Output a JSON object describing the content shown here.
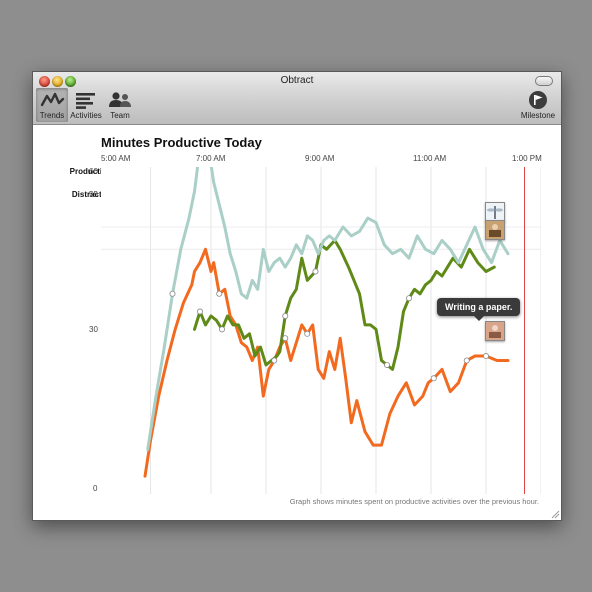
{
  "window": {
    "title": "Obtract"
  },
  "toolbar": {
    "trends_label": "Trends",
    "activities_label": "Activities",
    "team_label": "Team",
    "milestone_label": "Milestone"
  },
  "chart": {
    "title": "Minutes Productive Today",
    "x_ticks": [
      "5:00 AM",
      "7:00 AM",
      "9:00 AM",
      "11:00 AM",
      "1:00 PM"
    ],
    "y_productive_label": "Productive",
    "y_productive_value": "60",
    "y_distracted_label": "Distracted",
    "y_distracted_value": "55",
    "y_mid_value": "30",
    "y_zero_value": "0",
    "tooltip": "Writing a paper.",
    "footer": "Graph shows minutes spent on productive activities over the previous hour."
  },
  "colors": {
    "orange": "#f26a1f",
    "olive": "#5f8a17",
    "teal": "#a9cfc7",
    "marker": "#e04444"
  },
  "chart_data": {
    "type": "line",
    "x_unit": "hours (time of day, 5 = 5:00 AM, 13 = 1:00 PM)",
    "xlim": [
      5,
      13
    ],
    "ylim": [
      0,
      60
    ],
    "current_time_hour": 12.7,
    "series": [
      {
        "color": "#f26a1f",
        "x": [
          5.8,
          5.9,
          6.05,
          6.2,
          6.35,
          6.5,
          6.65,
          6.7,
          6.8,
          6.9,
          7.0,
          7.05,
          7.15,
          7.25,
          7.35,
          7.45,
          7.55,
          7.65,
          7.75,
          7.85,
          7.95,
          8.05,
          8.15,
          8.25,
          8.35,
          8.45,
          8.55,
          8.65,
          8.75,
          8.85,
          8.95,
          9.05,
          9.15,
          9.25,
          9.35,
          9.45,
          9.55,
          9.65,
          9.8,
          9.95,
          10.1,
          10.25,
          10.4,
          10.55,
          10.7,
          10.85,
          10.95,
          11.05,
          11.2,
          11.35,
          11.5,
          11.65,
          11.8,
          12.0,
          12.2,
          12.4
        ],
        "y": [
          4,
          12,
          22,
          30,
          37,
          43,
          47,
          50,
          52,
          55,
          50,
          52,
          45,
          46,
          40,
          38,
          34,
          33,
          30,
          33,
          22,
          28,
          30,
          33,
          35,
          30,
          34,
          38,
          36,
          38,
          28,
          26,
          32,
          28,
          35,
          26,
          16,
          21,
          14,
          11,
          11,
          18,
          22,
          25,
          20,
          22,
          25,
          26,
          28,
          23,
          25,
          30,
          31,
          31,
          30,
          30
        ]
      },
      {
        "color": "#5f8a17",
        "x": [
          6.7,
          6.8,
          6.9,
          7.0,
          7.1,
          7.2,
          7.3,
          7.4,
          7.5,
          7.6,
          7.7,
          7.8,
          7.9,
          8.0,
          8.1,
          8.2,
          8.25,
          8.35,
          8.45,
          8.55,
          8.65,
          8.75,
          8.9,
          9.0,
          9.1,
          9.25,
          9.35,
          9.5,
          9.6,
          9.7,
          9.8,
          9.9,
          10.0,
          10.1,
          10.2,
          10.3,
          10.4,
          10.5,
          10.6,
          10.7,
          10.8,
          10.9,
          11.0,
          11.1,
          11.2,
          11.3,
          11.4,
          11.55,
          11.7,
          11.85,
          12.0,
          12.15
        ],
        "y": [
          37,
          41,
          38,
          40,
          39,
          37,
          40,
          38,
          38,
          35,
          36,
          31,
          33,
          29,
          30,
          31,
          32,
          40,
          44,
          46,
          53,
          48,
          50,
          56,
          55,
          57,
          55,
          51,
          48,
          45,
          38,
          38,
          37,
          30,
          29,
          28,
          33,
          41,
          44,
          46,
          45,
          47,
          48,
          50,
          49,
          51,
          53,
          51,
          55,
          52,
          50,
          51
        ]
      },
      {
        "color": "#a9cfc7",
        "x": [
          5.85,
          6.0,
          6.15,
          6.3,
          6.45,
          6.6,
          6.7,
          6.75,
          6.8,
          6.85,
          6.95,
          7.05,
          7.15,
          7.25,
          7.35,
          7.45,
          7.55,
          7.65,
          7.75,
          7.85,
          7.95,
          8.05,
          8.15,
          8.25,
          8.35,
          8.45,
          8.55,
          8.65,
          8.75,
          8.85,
          8.95,
          9.05,
          9.15,
          9.25,
          9.4,
          9.55,
          9.7,
          9.85,
          10.0,
          10.15,
          10.3,
          10.45,
          10.6,
          10.75,
          10.9,
          11.05,
          11.2,
          11.35,
          11.5,
          11.65,
          11.8,
          11.95,
          12.1,
          12.25,
          12.4
        ],
        "y": [
          10,
          22,
          33,
          45,
          55,
          62,
          68,
          73,
          78,
          80,
          78,
          70,
          65,
          60,
          54,
          50,
          45,
          44,
          48,
          46,
          55,
          50,
          52,
          53,
          51,
          53,
          56,
          54,
          58,
          57,
          54,
          57,
          58,
          57,
          60,
          58,
          59,
          62,
          61,
          56,
          54,
          55,
          53,
          58,
          55,
          54,
          57,
          55,
          52,
          56,
          60,
          55,
          52,
          57,
          54
        ]
      }
    ],
    "annotations": [
      {
        "time_hour": 12.75,
        "label": "Writing a paper."
      }
    ]
  }
}
